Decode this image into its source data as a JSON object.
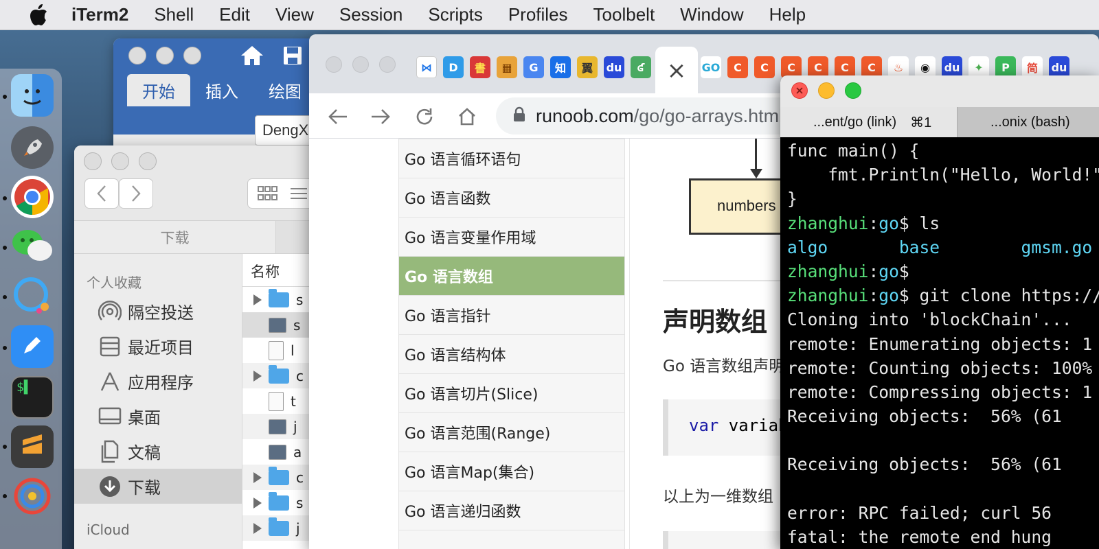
{
  "menubar": {
    "app": "iTerm2",
    "items": [
      "Shell",
      "Edit",
      "View",
      "Session",
      "Scripts",
      "Profiles",
      "Toolbelt",
      "Window",
      "Help"
    ]
  },
  "dock": {
    "apps": [
      "finder-icon",
      "launchpad-rocket-icon",
      "chrome-icon",
      "wechat-icon",
      "qq-icon",
      "notes-pen-icon",
      "iterm-icon",
      "sublime-icon",
      "app-icon"
    ]
  },
  "word": {
    "tabs": [
      "开始",
      "插入",
      "绘图"
    ],
    "font_value": "DengXian"
  },
  "finder": {
    "path_label": "下载",
    "favorites_header": "个人收藏",
    "sidebar": [
      "隔空投送",
      "最近项目",
      "应用程序",
      "桌面",
      "文稿",
      "下载"
    ],
    "icloud_header": "iCloud",
    "list_header": "名称",
    "files": [
      {
        "expand": true,
        "kind": "folder",
        "name": "s"
      },
      {
        "expand": false,
        "kind": "image",
        "name": "s"
      },
      {
        "expand": false,
        "kind": "doc",
        "name": "l"
      },
      {
        "expand": true,
        "kind": "folder",
        "name": "c"
      },
      {
        "expand": false,
        "kind": "doc",
        "name": "t"
      },
      {
        "expand": false,
        "kind": "image",
        "name": "j"
      },
      {
        "expand": false,
        "kind": "image",
        "name": "a"
      },
      {
        "expand": true,
        "kind": "folder",
        "name": "c"
      },
      {
        "expand": true,
        "kind": "folder",
        "name": "s"
      },
      {
        "expand": true,
        "kind": "folder",
        "name": "j"
      }
    ]
  },
  "chrome": {
    "pinned_tabs": [
      {
        "label": "⋈",
        "color": "#ffffff",
        "fg": "#1a73e8"
      },
      {
        "label": "D",
        "color": "#2f9be8",
        "fg": "#ffffff"
      },
      {
        "label": "書",
        "color": "#d93838",
        "fg": "#ffe14d"
      },
      {
        "label": "▦",
        "color": "#e8a33a",
        "fg": "#7a3d00"
      },
      {
        "label": "G",
        "color": "#4a86f0",
        "fg": "#ffffff"
      },
      {
        "label": "知",
        "color": "#1a6fe8",
        "fg": "#ffffff"
      },
      {
        "label": "翼",
        "color": "#e8b72e",
        "fg": "#333333"
      },
      {
        "label": "du",
        "color": "#2a4ad8",
        "fg": "#ffffff"
      },
      {
        "label": "ʛ",
        "color": "#4aaa62",
        "fg": "#ffffff"
      }
    ],
    "after_tabs": [
      {
        "label": "GO",
        "color": "#ffffff",
        "fg": "#29a9d6"
      },
      {
        "label": "C",
        "color": "#f05a2a",
        "fg": "#ffffff"
      },
      {
        "label": "C",
        "color": "#f05a2a",
        "fg": "#ffffff"
      },
      {
        "label": "C",
        "color": "#f05a2a",
        "fg": "#ffffff"
      },
      {
        "label": "C",
        "color": "#f05a2a",
        "fg": "#ffffff"
      },
      {
        "label": "C",
        "color": "#f05a2a",
        "fg": "#ffffff"
      },
      {
        "label": "C",
        "color": "#f05a2a",
        "fg": "#ffffff"
      },
      {
        "label": "♨",
        "color": "#ffffff",
        "fg": "#e84a1a"
      },
      {
        "label": "◉",
        "color": "#ffffff",
        "fg": "#111111"
      },
      {
        "label": "du",
        "color": "#2a4ad8",
        "fg": "#ffffff"
      },
      {
        "label": "✦",
        "color": "#ffffff",
        "fg": "#4caf50"
      },
      {
        "label": "P",
        "color": "#3ab85a",
        "fg": "#ffffff"
      },
      {
        "label": "简",
        "color": "#ffffff",
        "fg": "#e84a3a"
      },
      {
        "label": "du",
        "color": "#2a4ad8",
        "fg": "#ffffff"
      }
    ],
    "active_tab_close": "×",
    "url_host": "runoob.com",
    "url_path": "/go/go-arrays.html",
    "nav": [
      "Go 语言循环语句",
      "Go 语言函数",
      "Go 语言变量作用域",
      "Go 语言数组",
      "Go 语言指针",
      "Go 语言结构体",
      "Go 语言切片(Slice)",
      "Go 语言范围(Range)",
      "Go 语言Map(集合)",
      "Go 语言递归函数"
    ],
    "active_nav_index": 3,
    "diagram_label": "numbers",
    "heading": "声明数组",
    "para1": "Go 语言数组声明",
    "code_kw": "var",
    "code_rest": " variable_name",
    "para2": "以上为一维数组"
  },
  "iterm": {
    "tabs": [
      {
        "label": "...ent/go (link)",
        "key": "⌘1"
      },
      {
        "label": "...onix (bash)",
        "key": ""
      }
    ],
    "lines": [
      {
        "type": "plain",
        "text": "func main() {"
      },
      {
        "type": "plain",
        "text": "    fmt.Println(\"Hello, World!\")"
      },
      {
        "type": "plain",
        "text": "}"
      },
      {
        "type": "prompt",
        "user": "zhanghui",
        "dir": "go",
        "cmd": "$ ls"
      },
      {
        "type": "ls",
        "text": "algo       base        gmsm.go"
      },
      {
        "type": "prompt",
        "user": "zhanghui",
        "dir": "go",
        "cmd": "$"
      },
      {
        "type": "prompt",
        "user": "zhanghui",
        "dir": "go",
        "cmd": "$ git clone https://"
      },
      {
        "type": "plain",
        "text": "Cloning into 'blockChain'..."
      },
      {
        "type": "plain",
        "text": "remote: Enumerating objects: 1"
      },
      {
        "type": "plain",
        "text": "remote: Counting objects: 100%"
      },
      {
        "type": "plain",
        "text": "remote: Compressing objects: 1"
      },
      {
        "type": "plain",
        "text": "Receiving objects:  56% (61"
      },
      {
        "type": "plain",
        "text": ""
      },
      {
        "type": "plain",
        "text": "Receiving objects:  56% (61"
      },
      {
        "type": "plain",
        "text": ""
      },
      {
        "type": "plain",
        "text": "error: RPC failed; curl 56"
      },
      {
        "type": "plain",
        "text": "fatal: the remote end hung"
      }
    ]
  }
}
